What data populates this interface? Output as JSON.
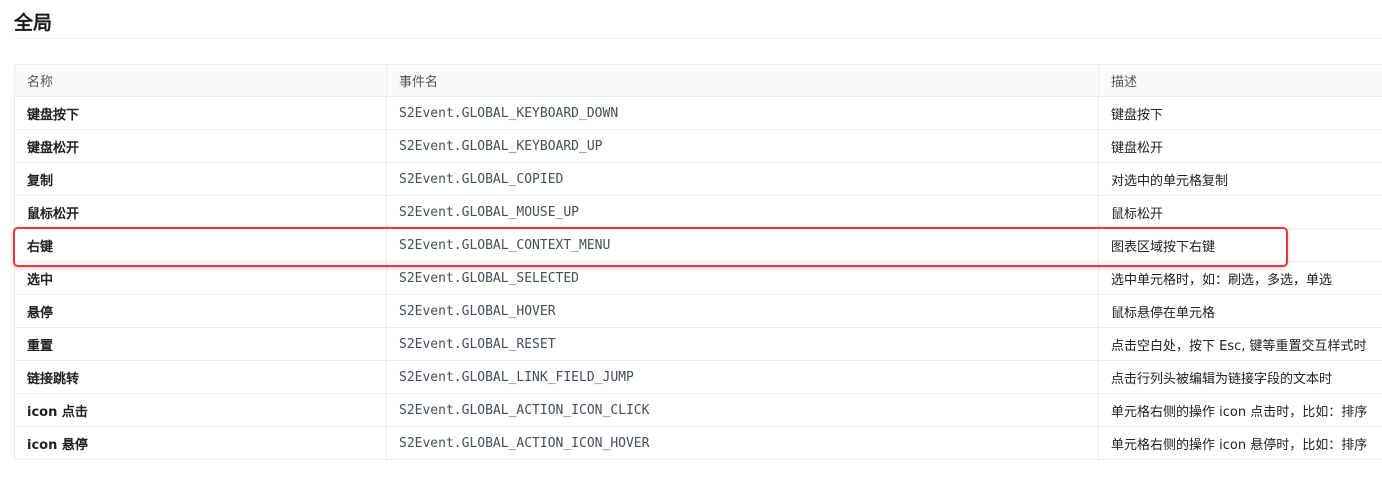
{
  "page": {
    "title": "全局"
  },
  "table": {
    "columns": [
      "名称",
      "事件名",
      "描述"
    ],
    "rows": [
      {
        "name": "键盘按下",
        "event": "S2Event.GLOBAL_KEYBOARD_DOWN",
        "desc": "键盘按下"
      },
      {
        "name": "键盘松开",
        "event": "S2Event.GLOBAL_KEYBOARD_UP",
        "desc": "键盘松开"
      },
      {
        "name": "复制",
        "event": "S2Event.GLOBAL_COPIED",
        "desc": "对选中的单元格复制"
      },
      {
        "name": "鼠标松开",
        "event": "S2Event.GLOBAL_MOUSE_UP",
        "desc": "鼠标松开"
      },
      {
        "name": "右键",
        "event": "S2Event.GLOBAL_CONTEXT_MENU",
        "desc": "图表区域按下右键"
      },
      {
        "name": "选中",
        "event": "S2Event.GLOBAL_SELECTED",
        "desc": "选中单元格时，如：刷选，多选，单选"
      },
      {
        "name": "悬停",
        "event": "S2Event.GLOBAL_HOVER",
        "desc": "鼠标悬停在单元格"
      },
      {
        "name": "重置",
        "event": "S2Event.GLOBAL_RESET",
        "desc": "点击空白处，按下 Esc, 键等重置交互样式时"
      },
      {
        "name": "链接跳转",
        "event": "S2Event.GLOBAL_LINK_FIELD_JUMP",
        "desc": "点击行列头被编辑为链接字段的文本时"
      },
      {
        "name": "icon 点击",
        "event": "S2Event.GLOBAL_ACTION_ICON_CLICK",
        "desc": "单元格右侧的操作 icon 点击时，比如：排序"
      },
      {
        "name": "icon 悬停",
        "event": "S2Event.GLOBAL_ACTION_ICON_HOVER",
        "desc": "单元格右侧的操作 icon 悬停时，比如：排序"
      }
    ]
  },
  "highlight": {
    "row_index": 4,
    "color": "#e33b3b"
  },
  "colors": {
    "header_bg": "#fafafa",
    "border": "#ececec",
    "code_text": "#454f5e"
  }
}
